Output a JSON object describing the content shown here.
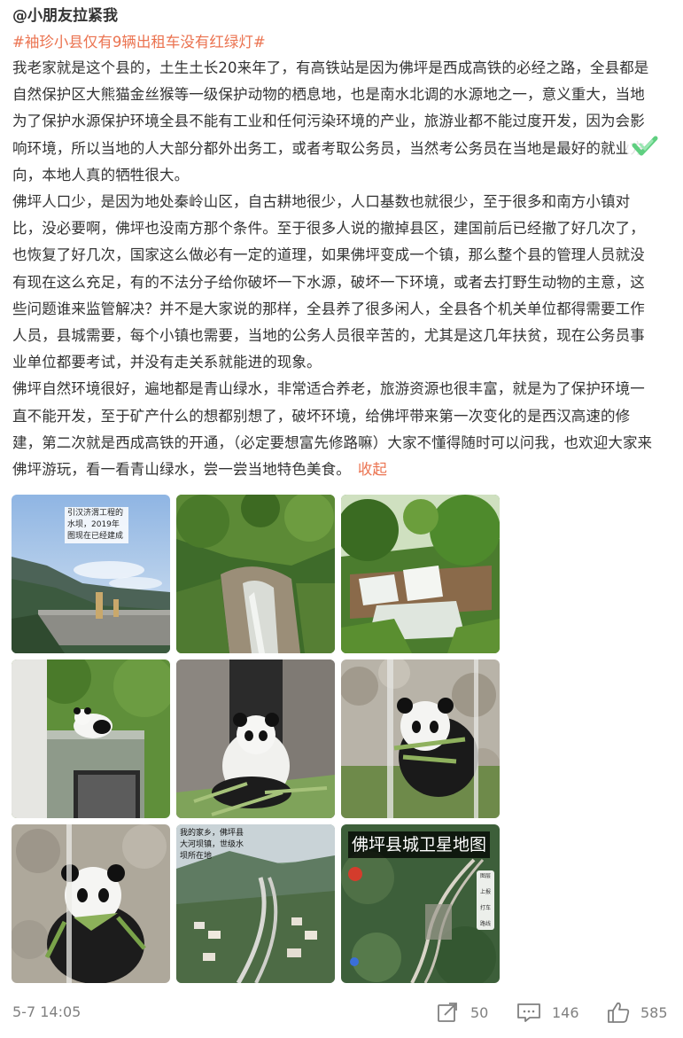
{
  "post": {
    "username": "@小朋友拉紧我",
    "topic": "#袖珍小县仅有9辆出租车没有红绿灯#",
    "paragraphs": [
      "我老家就是这个县的，土生土长20来年了，有高铁站是因为佛坪是西成高铁的必经之路，全县都是自然保护区大熊猫金丝猴等一级保护动物的栖息地，也是南水北调的水源地之一，意义重大，当地为了保护水源保护环境全县不能有工业和任何污染环境的产业，旅游业都不能过度开发，因为会影响环境，所以当地的人大部分都外出务工，或者考取公务员，当然考公务员在当地是最好的就业方向，本地人真的牺牲很大。",
      "佛坪人口少，是因为地处秦岭山区，自古耕地很少，人口基数也就很少，至于很多和南方小镇对比，没必要啊，佛坪也没南方那个条件。至于很多人说的撤掉县区，建国前后已经撤了好几次了，也恢复了好几次，国家这么做必有一定的道理，如果佛坪变成一个镇，那么整个县的管理人员就没有现在这么充足，有的不法分子给你破坏一下水源，破坏一下环境，或者去打野生动物的主意，这些问题谁来监管解决？并不是大家说的那样，全县养了很多闲人，全县各个机关单位都得需要工作人员，县城需要，每个小镇也需要，当地的公务人员很辛苦的，尤其是这几年扶贫，现在公务员事业单位都要考试，并没有走关系就能进的现象。",
      "佛坪自然环境很好，遍地都是青山绿水，非常适合养老，旅游资源也很丰富，就是为了保护环境一直不能开发，至于矿产什么的想都别想了，破坏环境，给佛坪带来第一次变化的是西汉高速的修建，第二次就是西成高铁的开通，（必定要想富先修路嘛）大家不懂得随时可以问我，也欢迎大家来佛坪游玩，看一看青山绿水，尝一尝当地特色美食。"
    ],
    "collapse_label": "收起",
    "images": {
      "dam_caption": "引汉济渭工程的水坝，2019年图现在已经建成",
      "town_caption": "我的家乡，佛坪县大河坝镇，世级水坝所在地",
      "map_title": "佛坪县城卫星地图",
      "map_tools": [
        "图层",
        "上报",
        "打车",
        "路线"
      ]
    }
  },
  "footer": {
    "time": "5-7 14:05",
    "repost_count": "50",
    "comment_count": "146",
    "like_count": "585"
  },
  "colors": {
    "accent": "#eb7350",
    "text": "#333333",
    "muted": "#808080"
  }
}
